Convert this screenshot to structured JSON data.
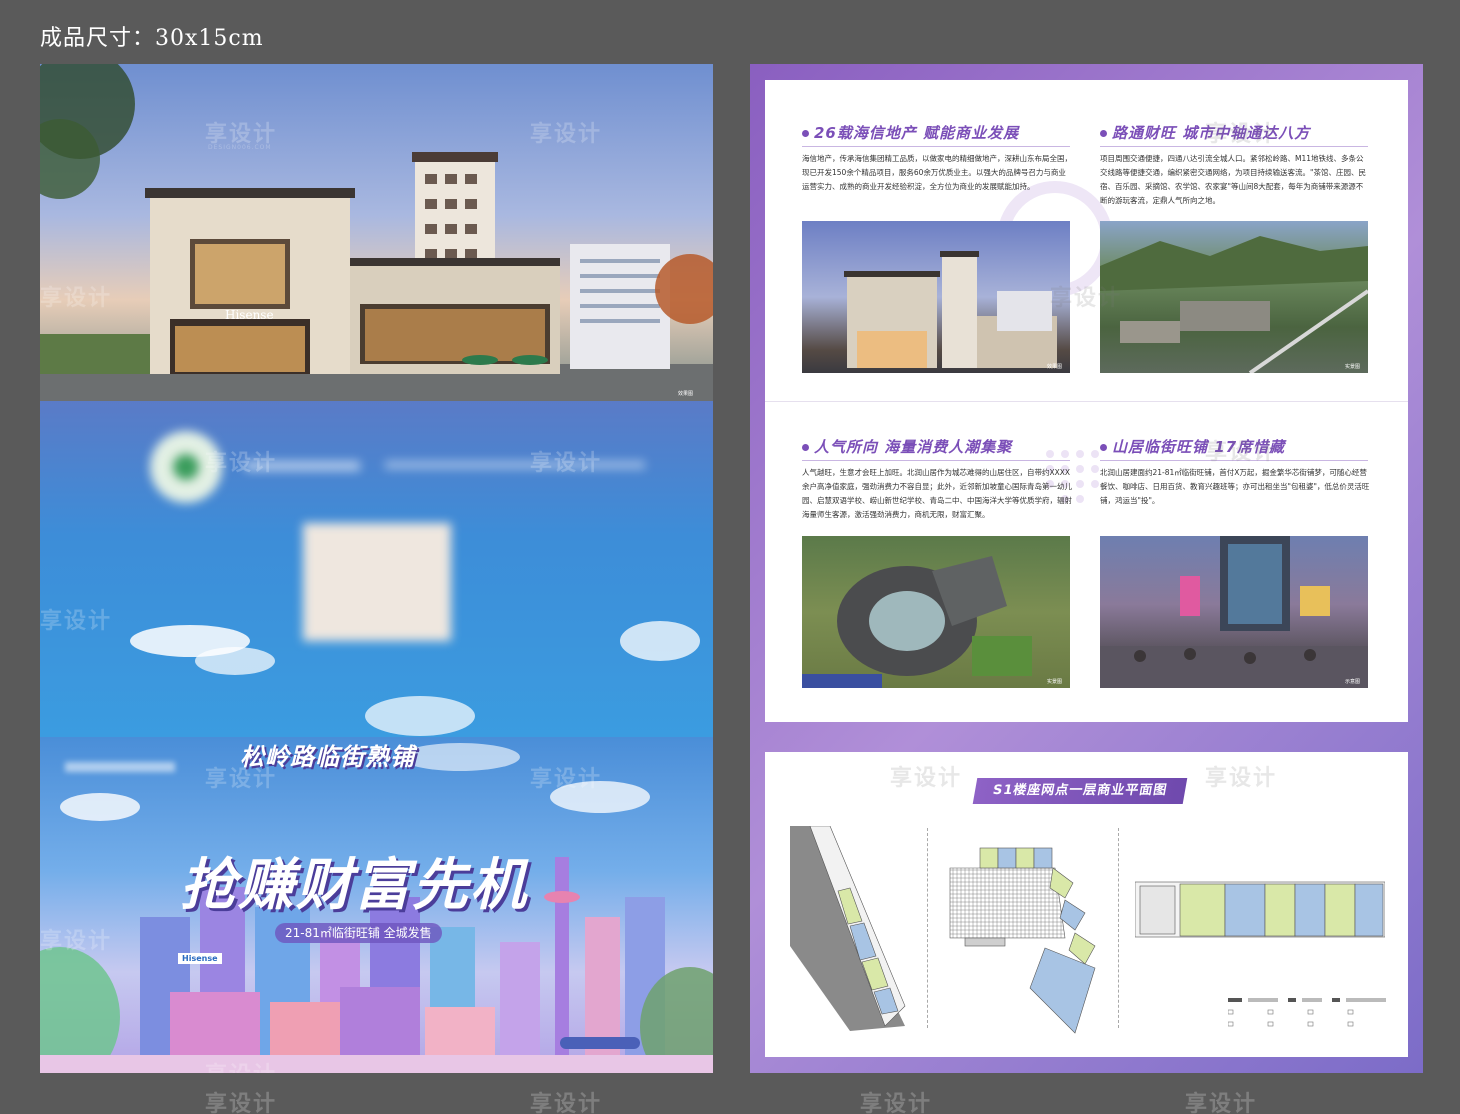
{
  "header": {
    "size_label": "成品尺寸：30x15cm"
  },
  "watermark": {
    "brand": "享设计",
    "brand_sub": "DESIGN006.COM"
  },
  "left_sheet": {
    "photo_panel": {
      "storefront_sign": "Hisense",
      "caption": "效果图"
    },
    "cover": {
      "title_line1": "松岭路临街熟铺",
      "title_line2": "抢赚财富先机",
      "tagline": "21-81㎡临街旺铺 全城发售",
      "brand_logo": "Hisense"
    }
  },
  "right_sheet": {
    "sections": [
      {
        "title": "26载海信地产 赋能商业发展",
        "body": "海信地产，传承海信集团精工品质，以做家电的精细做地产，深耕山东布局全国，现已开发150余个精品项目，服务60余万优质业主。以强大的品牌号召力与商业运营实力、成熟的商业开发经验积淀，全方位为商业的发展赋能加持。",
        "caption": "效果图"
      },
      {
        "title": "路通财旺 城市中轴通达八方",
        "body": "项目周围交通便捷，四通八达引流全城人口。紧邻松岭路、M11地铁线、多条公交线路等便捷交通，编织紧密交通网络，为项目持续输送客流。\"茶馆、庄园、民宿、百乐园、采摘馆、农学馆、农家宴\"等山间8大配套，每年为商铺带来源源不断的游玩客流，定鼎人气所向之地。",
        "caption": "实景图"
      },
      {
        "title": "人气所向 海量消费人潮集聚",
        "body": "人气越旺，生意才会旺上加旺。北润山居作为城芯难得的山居住区，自带约XXXX余户高净值家庭，强劲消费力不容自显；此外，近邻新加坡童心国际青岛第一幼儿园、启慧双语学校、崂山新世纪学校、青岛二中、中国海洋大学等优质学府，辐射海量师生客源，激活强劲消费力，商机无限，财富汇聚。",
        "caption": "实景图"
      },
      {
        "title": "山居临街旺铺 17席惜藏",
        "body": "北润山居建面约21-81㎡临街旺铺，首付X万起，掘金繁华芯街铺梦，可随心经营餐饮、咖啡店、日用百货、教育兴趣班等；亦可出租坐当\"包租婆\"，低总价灵活旺铺，鸿运当\"投\"。",
        "caption": "示意图"
      }
    ],
    "plan": {
      "title": "S1楼座网点一层商业平面图"
    }
  },
  "colors": {
    "accent_purple": "#7b4fb8",
    "sheet_background": "#5a5a5a",
    "plan_unit_green": "#d9e8a8",
    "plan_unit_blue": "#a8c4e4"
  }
}
